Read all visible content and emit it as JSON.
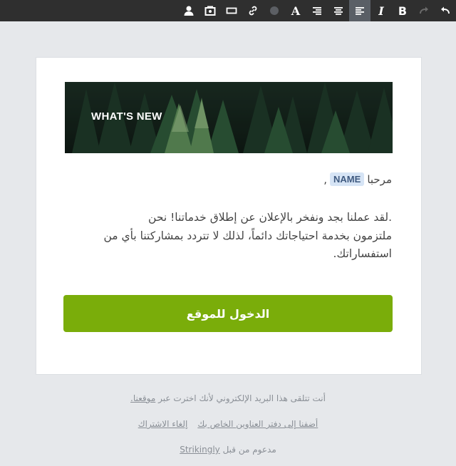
{
  "toolbar": {
    "buttons": [
      {
        "icon": "undo-icon",
        "label": ""
      },
      {
        "icon": "redo-icon",
        "label": ""
      },
      {
        "icon": "bold-icon",
        "label": "B"
      },
      {
        "icon": "italic-icon",
        "label": "I"
      },
      {
        "icon": "align-right-icon",
        "label": ""
      },
      {
        "icon": "align-center-icon",
        "label": ""
      },
      {
        "icon": "align-left-icon",
        "label": ""
      },
      {
        "icon": "font-color-icon",
        "label": "A"
      },
      {
        "icon": "color-picker-icon",
        "label": ""
      },
      {
        "icon": "link-icon",
        "label": ""
      },
      {
        "icon": "button-icon",
        "label": ""
      },
      {
        "icon": "image-icon",
        "label": ""
      },
      {
        "icon": "user-icon",
        "label": ""
      }
    ],
    "active_button": "align-right-icon",
    "disabled_button": "redo-icon"
  },
  "email": {
    "banner_title": "WHAT'S NEW",
    "greeting_word": "مرحبا",
    "name_tag": "NAME",
    "greeting_comma": ",",
    "body_line1": ".لقد عملنا بجد ونفخر بالإعلان عن إطلاق خدماتنا! نحن",
    "body_line2": "ملتزمون بخدمة احتياجاتك دائماً، لذلك لا تتردد بمشاركتنا بأي من",
    "body_line3": "استفساراتك.",
    "cta_label": "الدخول للموقع"
  },
  "footer": {
    "reason_text": "أنت تتلقى هذا البريد الإلكتروني لأنك اخترت عبر",
    "reason_link": "موقعنا.",
    "add_address_link": "أضفنا إلى دفتر العناوين الخاص بك",
    "unsubscribe_link": "إلغاء الاشتراك",
    "powered_text": "مدعوم من قبل",
    "powered_link": "Strikingly"
  },
  "colors": {
    "toolbar_bg": "#2f2f2f",
    "page_bg": "#e6e8eb",
    "cta_bg": "#7aad0a",
    "name_tag_bg": "#d6e4f5"
  }
}
